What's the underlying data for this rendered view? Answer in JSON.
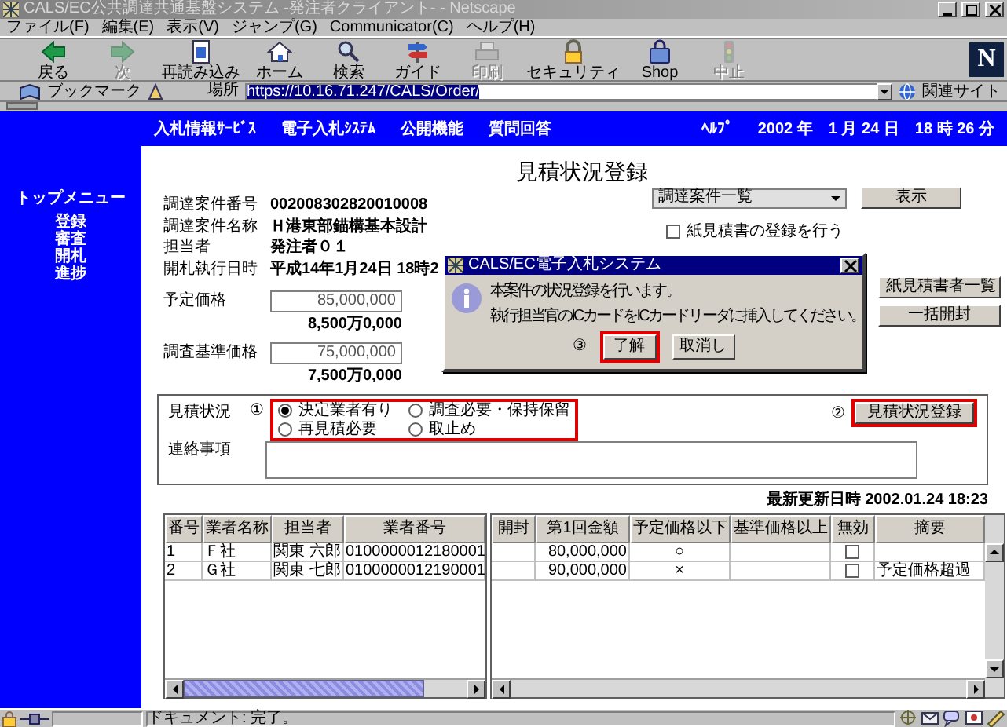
{
  "window": {
    "title": "CALS/EC公共調達共通基盤システム -発注者クライアント- - Netscape"
  },
  "menu": [
    "ファイル(F)",
    "編集(E)",
    "表示(V)",
    "ジャンプ(G)",
    "Communicator(C)",
    "ヘルプ(H)"
  ],
  "toolbar": [
    {
      "label": "戻る",
      "kind": "back",
      "disabled": false
    },
    {
      "label": "次",
      "kind": "forward",
      "disabled": true
    },
    {
      "label": "再読み込み",
      "kind": "reload",
      "disabled": false
    },
    {
      "label": "ホーム",
      "kind": "home",
      "disabled": false
    },
    {
      "label": "検索",
      "kind": "search",
      "disabled": false
    },
    {
      "label": "ガイド",
      "kind": "guide",
      "disabled": false
    },
    {
      "label": "印刷",
      "kind": "print",
      "disabled": true
    },
    {
      "label": "セキュリティ",
      "kind": "security",
      "disabled": false
    },
    {
      "label": "Shop",
      "kind": "shop",
      "disabled": false
    },
    {
      "label": "中止",
      "kind": "stop",
      "disabled": true
    }
  ],
  "browser_logo": "N",
  "location_bar": {
    "bookmarks": "ブックマーク",
    "label": "場所",
    "url": "https://10.16.71.247/CALS/Order/",
    "related": "関連サイト"
  },
  "site_nav": {
    "items": [
      "入札情報ｻｰﾋﾞｽ",
      "電子入札ｼｽﾃﾑ",
      "公開機能",
      "質問回答"
    ],
    "help": "ﾍﾙﾌﾟ",
    "date": "2002 年　1 月 24 日　18 時 26 分"
  },
  "side_menu": {
    "title": "トップメニュー",
    "items": [
      "登録",
      "審査",
      "開札",
      "進捗"
    ]
  },
  "page": {
    "title": "見積状況登録",
    "fields": [
      {
        "label": "調達案件番号",
        "value": "002008302820010008"
      },
      {
        "label": "調達案件名称",
        "value": "Ｈ港東部錨構基本設計"
      },
      {
        "label": "担当者",
        "value": "発注者０１"
      },
      {
        "label": "開札執行日時",
        "value": "平成14年1月24日 18時2"
      }
    ],
    "prices": [
      {
        "label": "予定価格",
        "value": "85,000,000",
        "reading": "8,500万0,000"
      },
      {
        "label": "調査基準価格",
        "value": "75,000,000",
        "reading": "7,500万0,000"
      }
    ],
    "case_select": "調達案件一覧",
    "show_button": "表示",
    "paper_checkbox": {
      "label": "紙見積書の登録を行う",
      "checked": false
    },
    "side_buttons": [
      "紙見積書者一覧",
      "一括開封"
    ]
  },
  "status_form": {
    "label": "見積状況",
    "marker": "①",
    "options_highlighted": true,
    "options": [
      {
        "label": "決定業者有り",
        "selected": true
      },
      {
        "label": "調査必要・保持保留",
        "selected": false
      },
      {
        "label": "再見積必要",
        "selected": false
      },
      {
        "label": "取止め",
        "selected": false
      }
    ],
    "register_marker": "②",
    "register_button": "見積状況登録",
    "register_highlighted": true,
    "notes_label": "連絡事項"
  },
  "updated": "最新更新日時 2002.01.24 18:23",
  "table": {
    "left_columns": [
      "番号",
      "業者名称",
      "担当者",
      "業者番号"
    ],
    "right_columns": [
      "開封",
      "第1回金額",
      "予定価格以下",
      "基準価格以上",
      "無効",
      "摘要"
    ],
    "rows": [
      {
        "number": "1",
        "vendor": "Ｆ社",
        "person": "関東 六郎",
        "vendor_number": "0100000012180001",
        "amount": "80,000,000",
        "below_planned": "○",
        "invalid": false
      },
      {
        "number": "2",
        "vendor": "Ｇ社",
        "person": "関東 七郎",
        "vendor_number": "0100000012190001",
        "amount": "90,000,000",
        "below_planned": "×",
        "invalid": false,
        "note": "予定価格超過"
      }
    ]
  },
  "dialog": {
    "title": "CALS/EC電子入札システム",
    "lines": [
      "本案件の状況登録を行います。",
      "執行担当官のICカードをICカードリーダに挿入してください。"
    ],
    "marker": "③",
    "buttons": [
      {
        "label": "了解",
        "highlighted": true
      },
      {
        "label": "取消し",
        "highlighted": false
      }
    ]
  },
  "status_bar": {
    "text": "ドキュメント: 完了。"
  }
}
